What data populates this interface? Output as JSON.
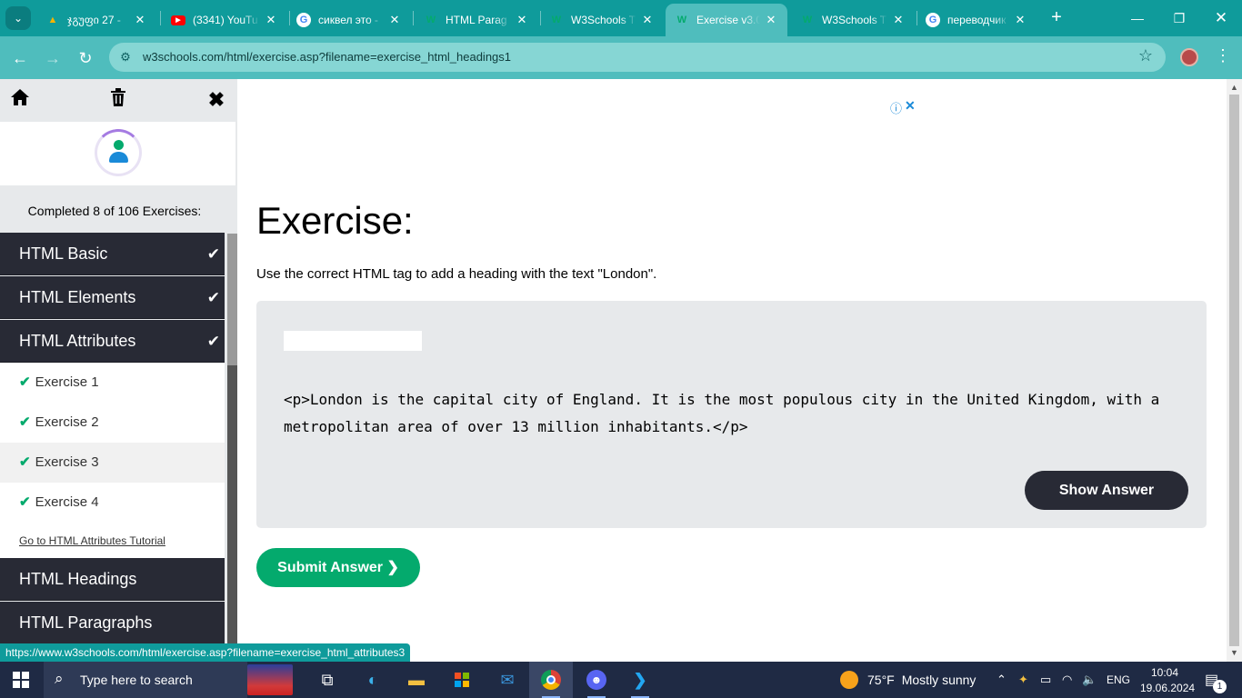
{
  "browser": {
    "tabs": [
      {
        "title": "ჯგუფი 27 -",
        "favicon": "google-drive-icon",
        "color": "#f4b400"
      },
      {
        "title": "(3341) YouTu",
        "favicon": "youtube-icon",
        "color": "#ff0000"
      },
      {
        "title": "сиквел это -",
        "favicon": "google-icon",
        "color": "#4285f4"
      },
      {
        "title": "HTML Parag",
        "favicon": "w3schools-icon",
        "color": "#04aa6d"
      },
      {
        "title": "W3Schools T",
        "favicon": "w3schools-icon",
        "color": "#04aa6d"
      },
      {
        "title": "Exercise v3.0",
        "favicon": "w3schools-icon",
        "color": "#04aa6d"
      },
      {
        "title": "W3Schools T",
        "favicon": "w3schools-icon",
        "color": "#04aa6d"
      },
      {
        "title": "переводчик",
        "favicon": "google-icon",
        "color": "#4285f4"
      }
    ],
    "active_tab_index": 5,
    "url": "w3schools.com/html/exercise.asp?filename=exercise_html_headings1",
    "status_url": "https://www.w3schools.com/html/exercise.asp?filename=exercise_html_attributes3"
  },
  "sidebar": {
    "completed": "Completed 8 of 106 Exercises:",
    "sections": [
      {
        "label": "HTML Basic",
        "done": true
      },
      {
        "label": "HTML Elements",
        "done": true
      },
      {
        "label": "HTML Attributes",
        "done": true
      },
      {
        "label": "HTML Headings",
        "done": false
      },
      {
        "label": "HTML Paragraphs",
        "done": false
      }
    ],
    "exercises": [
      {
        "label": "Exercise 1"
      },
      {
        "label": "Exercise 2"
      },
      {
        "label": "Exercise 3"
      },
      {
        "label": "Exercise 4"
      }
    ],
    "tutorial_link": "Go to HTML Attributes Tutorial"
  },
  "main": {
    "title": "Exercise:",
    "instruction": "Use the correct HTML tag to add a heading with the text \"London\".",
    "answer_value": "",
    "code": "<p>London is the capital city of England. It is the most populous city in the United Kingdom, with a metropolitan area of over 13 million inhabitants.</p>",
    "show_answer": "Show Answer",
    "submit": "Submit Answer ❯"
  },
  "taskbar": {
    "search_placeholder": "Type here to search",
    "weather_temp": "75°F",
    "weather_text": "Mostly sunny",
    "language": "ENG",
    "time": "10:04",
    "date": "19.06.2024",
    "notifications": "1"
  },
  "colors": {
    "chrome_frame": "#0f9b9b",
    "w3_green": "#04aa6d",
    "w3_dark": "#282a35"
  }
}
